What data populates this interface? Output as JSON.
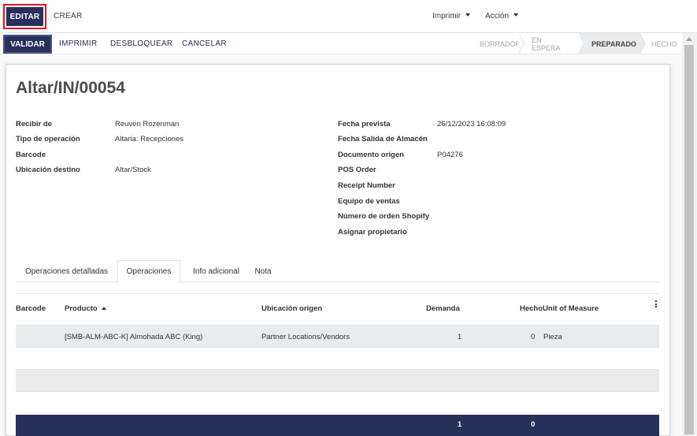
{
  "control_panel": {
    "edit_label": "EDITAR",
    "create_label": "CREAR",
    "print_menu": "Imprimir",
    "action_menu": "Acción"
  },
  "statusbar": {
    "buttons": [
      "VALIDAR",
      "IMPRIMIR",
      "DESBLOQUEAR",
      "CANCELAR"
    ],
    "stages": [
      {
        "label": "BORRADOR",
        "active": false
      },
      {
        "label": "EN ESPERA",
        "active": false
      },
      {
        "label": "PREPARADO",
        "active": true
      },
      {
        "label": "HECHO",
        "active": false
      }
    ]
  },
  "record": {
    "name": "Altar/IN/00054",
    "left_fields": [
      {
        "label": "Recibir de",
        "value": "Reuven Rozenman"
      },
      {
        "label": "Tipo de operación",
        "value": "Altaria: Recepciones"
      },
      {
        "label": "Barcode",
        "value": ""
      },
      {
        "label": "Ubicación destino",
        "value": "Altar/Stock"
      }
    ],
    "right_fields": [
      {
        "label": "Fecha prevista",
        "value": "26/12/2023 16:08:09"
      },
      {
        "label": "Fecha Salida de Almacén",
        "value": ""
      },
      {
        "label": "Documento origen",
        "value": "P04276"
      },
      {
        "label": "POS Order",
        "value": ""
      },
      {
        "label": "Receipt Number",
        "value": ""
      },
      {
        "label": "Equipo de ventas",
        "value": ""
      },
      {
        "label": "Número de orden Shopify",
        "value": ""
      },
      {
        "label": "Asignar propietario",
        "value": ""
      }
    ]
  },
  "tabs": [
    {
      "label": "Operaciones detalladas",
      "active": false
    },
    {
      "label": "Operaciones",
      "active": true
    },
    {
      "label": "Info adicional",
      "active": false
    },
    {
      "label": "Nota",
      "active": false
    }
  ],
  "table": {
    "headers": {
      "barcode": "Barcode",
      "product": "Producto",
      "source": "Ubicación origen",
      "demand": "Demanda",
      "done_uom": "HechoUnit of Measure"
    },
    "rows": [
      {
        "barcode": "",
        "product": "[SMB-ALM-ABC-K] Almohada ABC (King)",
        "source": "Partner Locations/Vendors",
        "demand": "1",
        "done": "0",
        "uom": "Pieza"
      }
    ],
    "totals": {
      "demand": "1",
      "done": "0"
    }
  },
  "colors": {
    "primary": "#28305c",
    "highlight_border": "#e0161d",
    "row_bg": "#e9ecef"
  }
}
